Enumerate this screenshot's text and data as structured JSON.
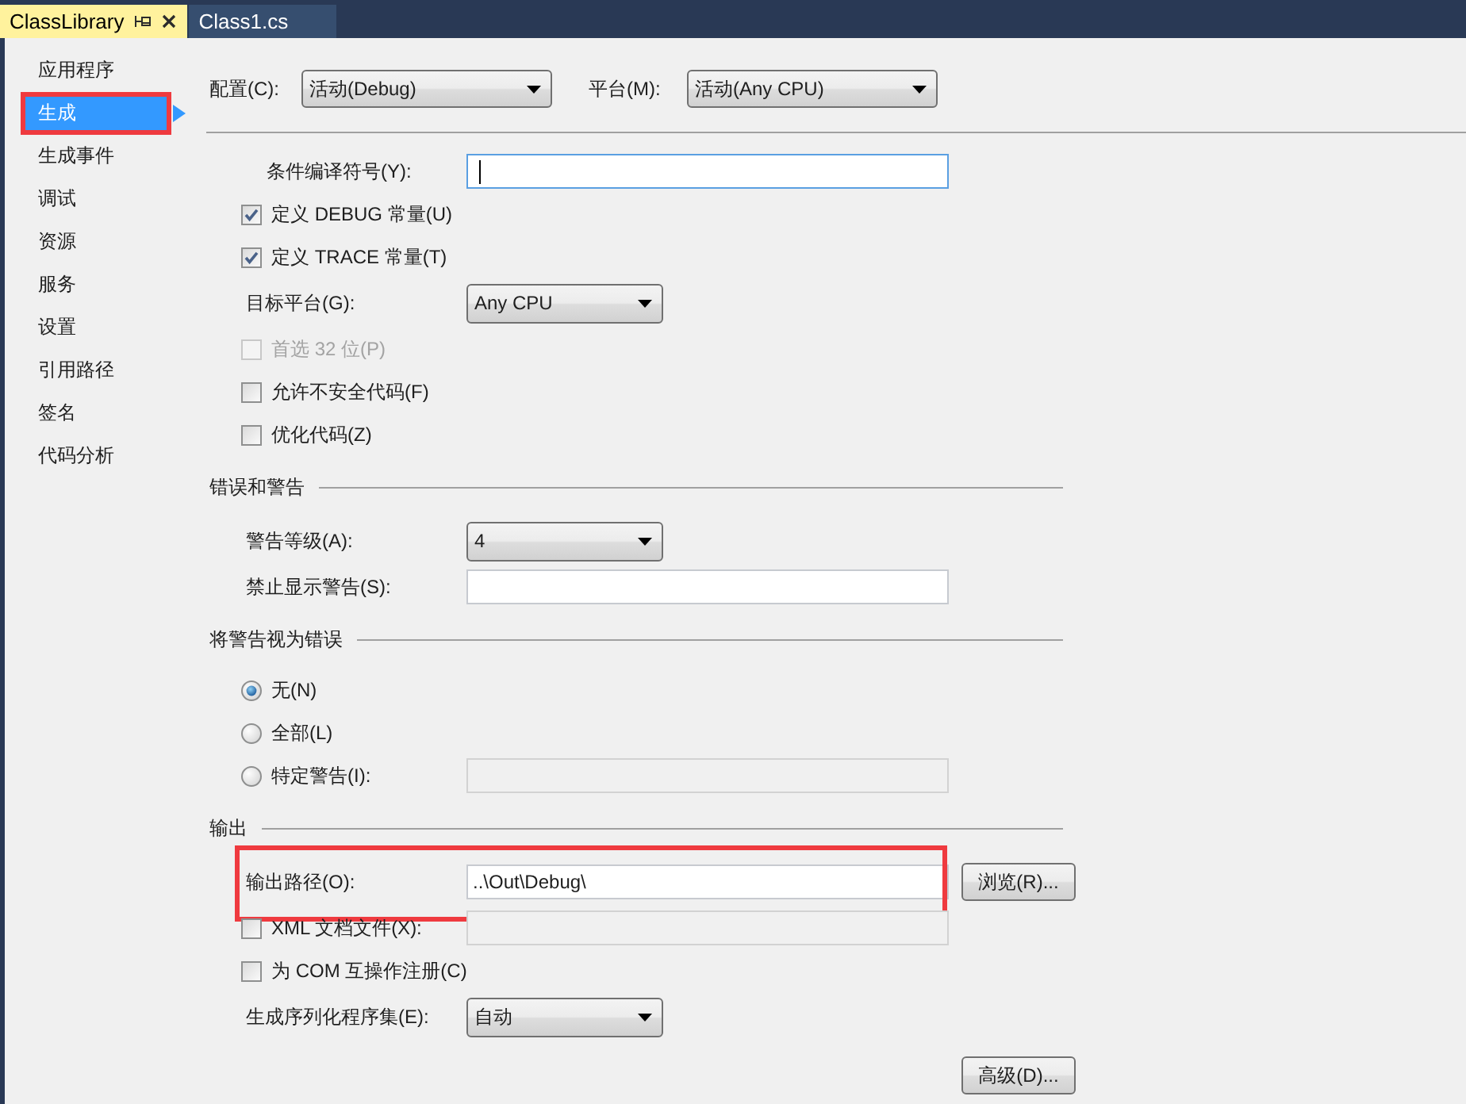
{
  "tabs": [
    {
      "label": "ClassLibrary",
      "selected": true
    },
    {
      "label": "Class1.cs",
      "selected": false
    }
  ],
  "sidebar": {
    "items": [
      {
        "label": "应用程序",
        "selected": false,
        "highlighted": false
      },
      {
        "label": "生成",
        "selected": true,
        "highlighted": true
      },
      {
        "label": "生成事件",
        "selected": false,
        "highlighted": false
      },
      {
        "label": "调试",
        "selected": false,
        "highlighted": false
      },
      {
        "label": "资源",
        "selected": false,
        "highlighted": false
      },
      {
        "label": "服务",
        "selected": false,
        "highlighted": false
      },
      {
        "label": "设置",
        "selected": false,
        "highlighted": false
      },
      {
        "label": "引用路径",
        "selected": false,
        "highlighted": false
      },
      {
        "label": "签名",
        "selected": false,
        "highlighted": false
      },
      {
        "label": "代码分析",
        "selected": false,
        "highlighted": false
      }
    ]
  },
  "toolbar": {
    "fields": [
      {
        "label": "配置(C):",
        "value": "活动(Debug)"
      },
      {
        "label": "平台(M):",
        "value": "活动(Any CPU)"
      }
    ]
  },
  "general": {
    "rows": [
      {
        "kind": "text",
        "label": "条件编译符号(Y):",
        "focused": true,
        "highlighted": false
      },
      {
        "kind": "checkbox",
        "label": "定义 DEBUG 常量(U)",
        "checked": true,
        "disabled": false,
        "highlighted": false
      },
      {
        "kind": "checkbox",
        "label": "定义 TRACE 常量(T)",
        "checked": true,
        "disabled": false,
        "highlighted": false
      },
      {
        "kind": "select",
        "label": "目标平台(G):",
        "value": "Any CPU",
        "highlighted": false
      },
      {
        "kind": "checkbox",
        "label": "首选 32 位(P)",
        "checked": false,
        "disabled": true,
        "highlighted": false
      },
      {
        "kind": "checkbox",
        "label": "允许不安全代码(F)",
        "checked": false,
        "disabled": false,
        "highlighted": false
      },
      {
        "kind": "checkbox",
        "label": "优化代码(Z)",
        "checked": false,
        "disabled": false,
        "highlighted": false
      }
    ]
  },
  "sections": [
    {
      "title": "错误和警告",
      "rows": [
        {
          "kind": "select",
          "label": "警告等级(A):",
          "value": "4",
          "highlighted": false
        },
        {
          "kind": "text",
          "label": "禁止显示警告(S):",
          "focused": false,
          "highlighted": false
        }
      ]
    },
    {
      "title": "将警告视为错误",
      "rows": [
        {
          "kind": "radio",
          "label": "无(N)",
          "selected": true,
          "highlighted": false
        },
        {
          "kind": "radio",
          "label": "全部(L)",
          "selected": false,
          "highlighted": false
        },
        {
          "kind": "radio",
          "label": "特定警告(I):",
          "selected": false,
          "highlighted": false,
          "field": {
            "disabled": true
          }
        }
      ]
    },
    {
      "title": "输出",
      "rows": [
        {
          "kind": "text",
          "label": "输出路径(O):",
          "value": "..\\Out\\Debug\\",
          "focused": false,
          "highlighted": true,
          "button": "浏览(R)..."
        },
        {
          "kind": "checkbox",
          "label": "XML 文档文件(X):",
          "checked": false,
          "disabled": false,
          "highlighted": false,
          "field": {
            "disabled": true
          }
        },
        {
          "kind": "checkbox",
          "label": "为 COM 互操作注册(C)",
          "checked": false,
          "disabled": false,
          "highlighted": false
        },
        {
          "kind": "select",
          "label": "生成序列化程序集(E):",
          "value": "自动",
          "highlighted": false
        },
        {
          "kind": "button",
          "label": "高级(D)...",
          "highlighted": false
        }
      ]
    }
  ]
}
